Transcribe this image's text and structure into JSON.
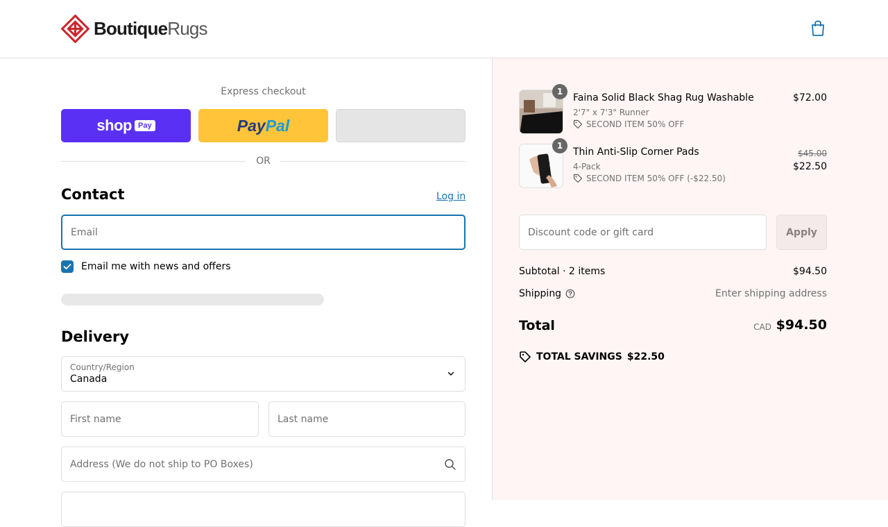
{
  "brand": {
    "name_bold": "Boutique",
    "name_regular": "Rugs"
  },
  "express": {
    "label": "Express checkout",
    "shop_text": "shop",
    "shop_pay_badge": "Pay",
    "paypal_part1": "Pay",
    "paypal_part2": "Pal",
    "divider": "OR"
  },
  "contact": {
    "title": "Contact",
    "login": "Log in",
    "email_placeholder": "Email",
    "news_checkbox_label": "Email me with news and offers",
    "news_checked": true
  },
  "delivery": {
    "title": "Delivery",
    "country_label": "Country/Region",
    "country_value": "Canada",
    "first_name_placeholder": "First name",
    "last_name_placeholder": "Last name",
    "address_placeholder": "Address (We do not ship to PO Boxes)"
  },
  "cart": {
    "items": [
      {
        "qty": "1",
        "name": "Faina Solid Black Shag Rug Washable",
        "variant": "2'7\" x 7'3\" Runner",
        "discount": "SECOND ITEM 50% OFF",
        "price": "$72.00"
      },
      {
        "qty": "1",
        "name": "Thin Anti-Slip Corner Pads",
        "variant": "4-Pack",
        "discount": "SECOND ITEM 50% OFF (-$22.50)",
        "old_price": "$45.00",
        "price": "$22.50"
      }
    ],
    "discount_placeholder": "Discount code or gift card",
    "apply_label": "Apply",
    "subtotal_label": "Subtotal · 2 items",
    "subtotal_value": "$94.50",
    "shipping_label": "Shipping",
    "shipping_value": "Enter shipping address",
    "total_label": "Total",
    "currency": "CAD",
    "total_value": "$94.50",
    "savings_label": "TOTAL SAVINGS",
    "savings_value": "$22.50"
  },
  "colors": {
    "accent": "#1773b0",
    "shop_pay": "#5a31f4",
    "paypal": "#ffc439",
    "summary_bg": "#fff5f5",
    "logo_red": "#c8282e"
  }
}
